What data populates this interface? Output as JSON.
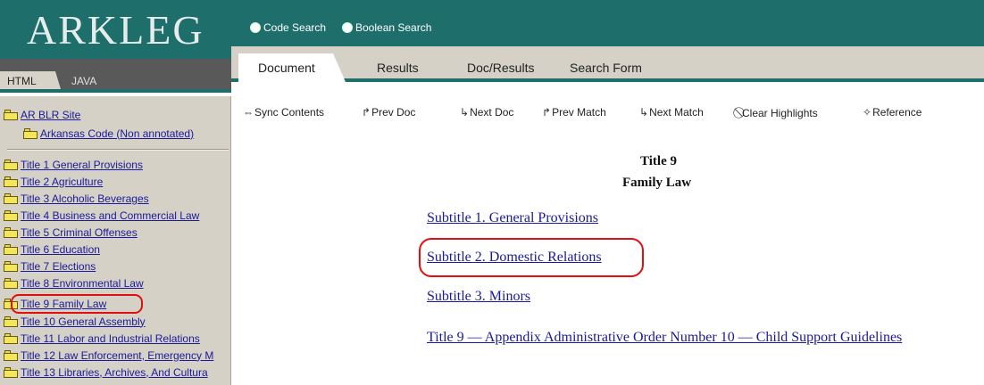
{
  "app": {
    "logo": "ARKLEG"
  },
  "search": {
    "options": [
      {
        "label": "Code Search"
      },
      {
        "label": "Boolean Search"
      }
    ]
  },
  "mode_tabs": {
    "html": "HTML",
    "java": "JAVA"
  },
  "tabs": [
    {
      "label": "Document",
      "active": true
    },
    {
      "label": "Results"
    },
    {
      "label": "Doc/Results"
    },
    {
      "label": "Search Form"
    }
  ],
  "toolbar": [
    {
      "label": "Sync Contents",
      "icon": "sync-arrows-icon"
    },
    {
      "label": "Prev Doc",
      "icon": "prev-doc-icon"
    },
    {
      "label": "Next Doc",
      "icon": "next-doc-icon"
    },
    {
      "label": "Prev Match",
      "icon": "prev-match-icon"
    },
    {
      "label": "Next Match",
      "icon": "next-match-icon"
    },
    {
      "label": "Clear Highlights",
      "icon": "clear-icon"
    },
    {
      "label": "Reference",
      "icon": "reference-icon"
    }
  ],
  "nav": {
    "top": [
      {
        "label": "AR BLR Site"
      },
      {
        "label": "Arkansas Code (Non annotated)"
      }
    ],
    "titles": [
      {
        "label": "Title 1 General Provisions"
      },
      {
        "label": "Title 2 Agriculture"
      },
      {
        "label": "Title 3 Alcoholic Beverages"
      },
      {
        "label": "Title 4 Business and Commercial Law"
      },
      {
        "label": "Title 5 Criminal Offenses"
      },
      {
        "label": "Title 6 Education"
      },
      {
        "label": "Title 7 Elections"
      },
      {
        "label": "Title 8 Environmental Law"
      },
      {
        "label": "Title 9 Family Law",
        "highlighted": true
      },
      {
        "label": "Title 10 General Assembly"
      },
      {
        "label": "Title 11 Labor and Industrial Relations"
      },
      {
        "label": "Title 12 Law Enforcement, Emergency M"
      },
      {
        "label": "Title 13 Libraries, Archives, And Cultura"
      }
    ]
  },
  "document": {
    "title": "Title 9",
    "heading": "Family Law",
    "links": [
      {
        "label": "Subtitle 1.  General Provisions"
      },
      {
        "label": "Subtitle 2. Domestic Relations",
        "highlighted": true
      },
      {
        "label": "Subtitle 3. Minors"
      },
      {
        "label": "Title 9 — Appendix Administrative Order Number 10 — Child Support Guidelines"
      }
    ]
  },
  "colors": {
    "header_teal": "#1e6e6c",
    "nav_bg": "#d5d1c6",
    "link": "#1a1a9a",
    "annotation_red": "#e01010"
  }
}
